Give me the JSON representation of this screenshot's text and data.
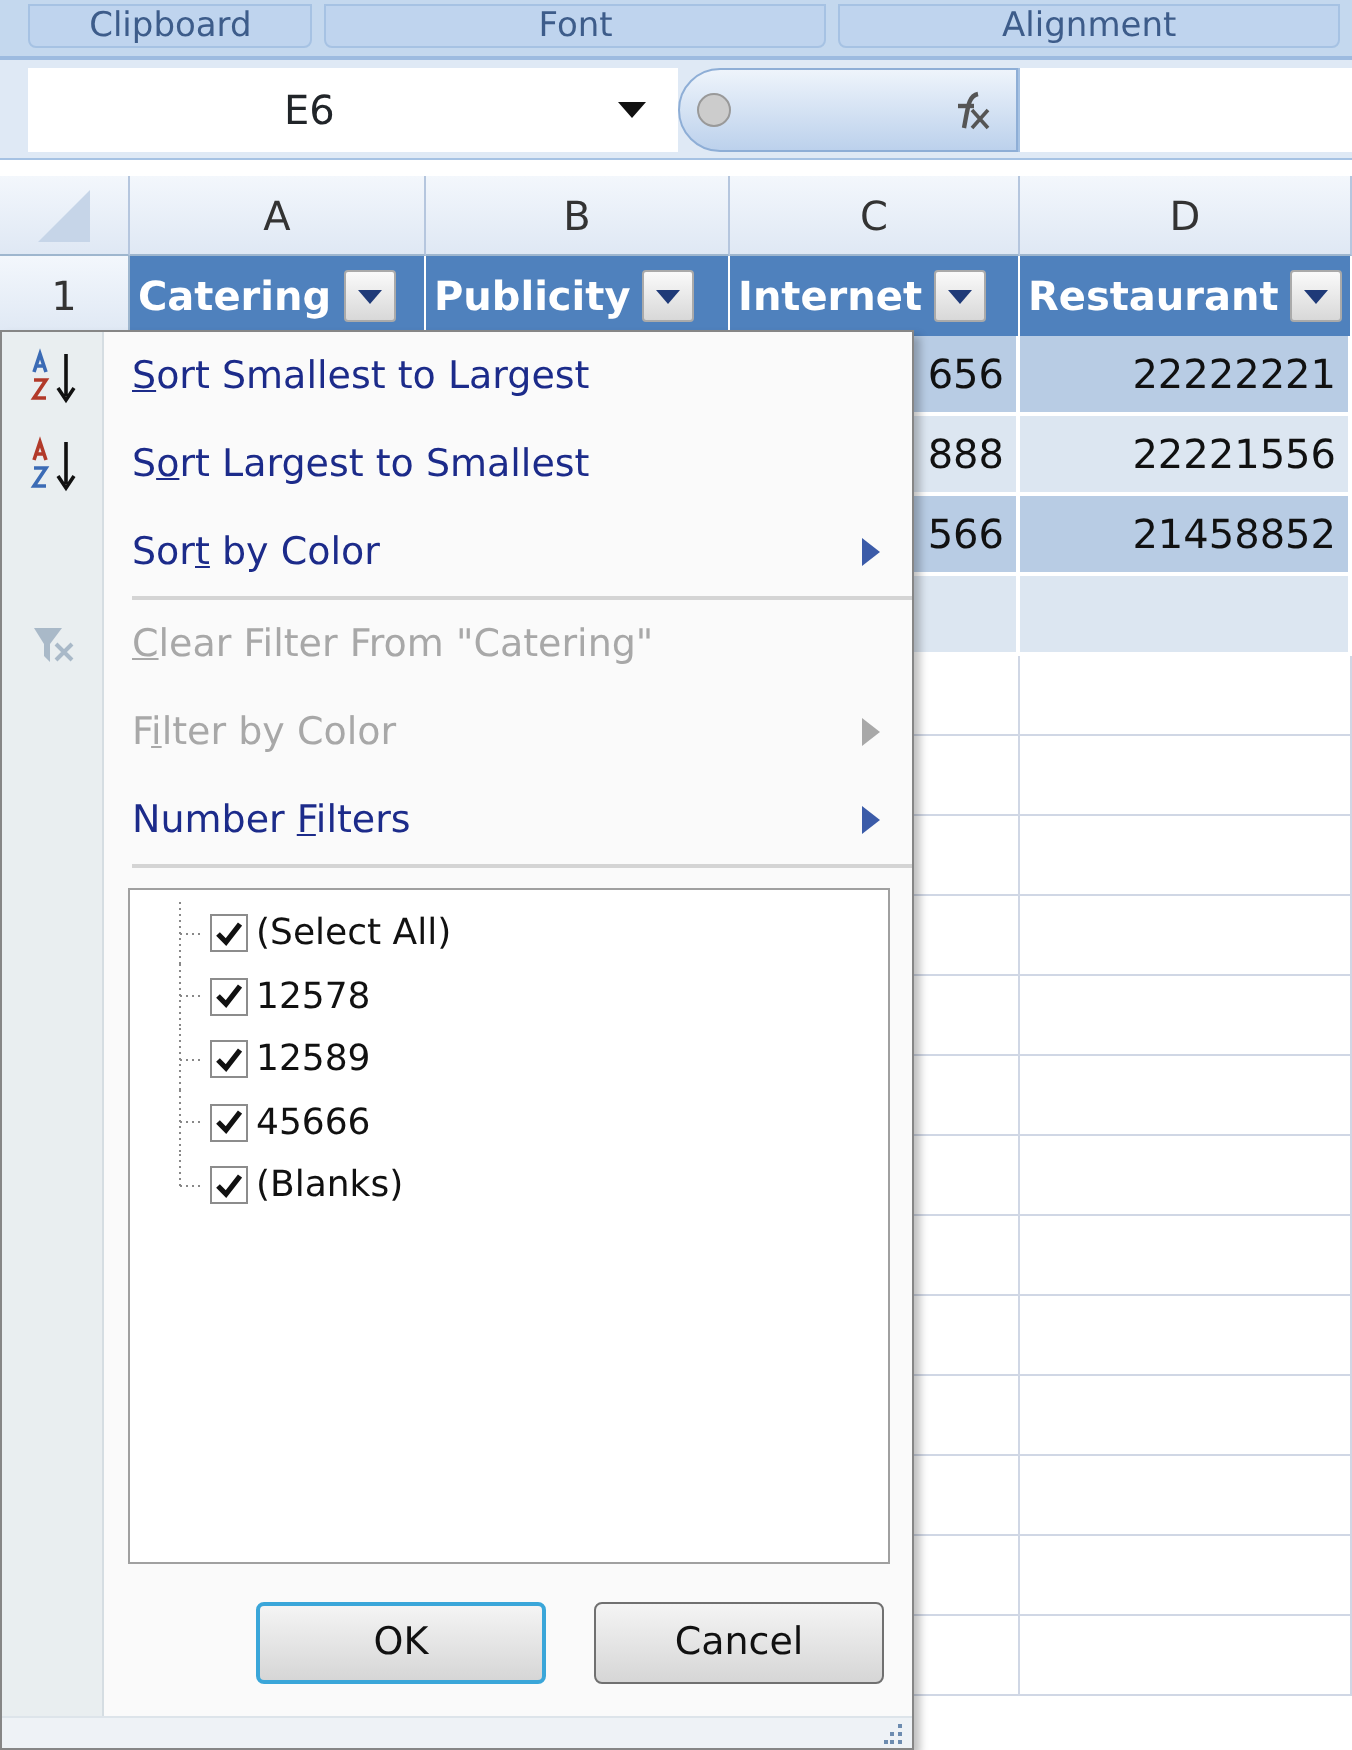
{
  "ribbon_groups": [
    {
      "label": "Clipboard"
    },
    {
      "label": "Font"
    },
    {
      "label": "Alignment"
    }
  ],
  "name_box": {
    "value": "E6"
  },
  "columns": [
    "A",
    "B",
    "C",
    "D"
  ],
  "header_row": {
    "number": "1",
    "cells": [
      "Catering",
      "Publicity",
      "Internet",
      "Restaurant"
    ]
  },
  "data_rows": [
    {
      "column_c": "656",
      "column_d": "22222221"
    },
    {
      "column_c": "888",
      "column_d": "22221556"
    },
    {
      "column_c": "566",
      "column_d": "21458852"
    }
  ],
  "filter_menu": {
    "items": [
      {
        "key": "S",
        "post": "ort Smallest to Largest",
        "disabled": false,
        "submenu": false,
        "separator_after": false
      },
      {
        "pre": "S",
        "key": "o",
        "post": "rt Largest to Smallest",
        "disabled": false,
        "submenu": false,
        "separator_after": false
      },
      {
        "pre": "Sor",
        "key": "t",
        "post": " by Color",
        "disabled": false,
        "submenu": true,
        "separator_after": true
      },
      {
        "key": "C",
        "post": "lear Filter From \"Catering\"",
        "disabled": true,
        "submenu": false,
        "separator_after": false
      },
      {
        "pre": "F",
        "key": "i",
        "post": "lter by Color",
        "disabled": true,
        "submenu": true,
        "separator_after": false
      },
      {
        "pre": "Number ",
        "key": "F",
        "post": "ilters",
        "disabled": false,
        "submenu": true,
        "separator_after": true
      }
    ],
    "values": [
      {
        "label": "(Select All)",
        "checked": true
      },
      {
        "label": "12578",
        "checked": true
      },
      {
        "label": "12589",
        "checked": true
      },
      {
        "label": "45666",
        "checked": true
      },
      {
        "label": "(Blanks)",
        "checked": true
      }
    ],
    "buttons": [
      {
        "label": "OK",
        "default": true
      },
      {
        "label": "Cancel",
        "default": false
      }
    ]
  }
}
